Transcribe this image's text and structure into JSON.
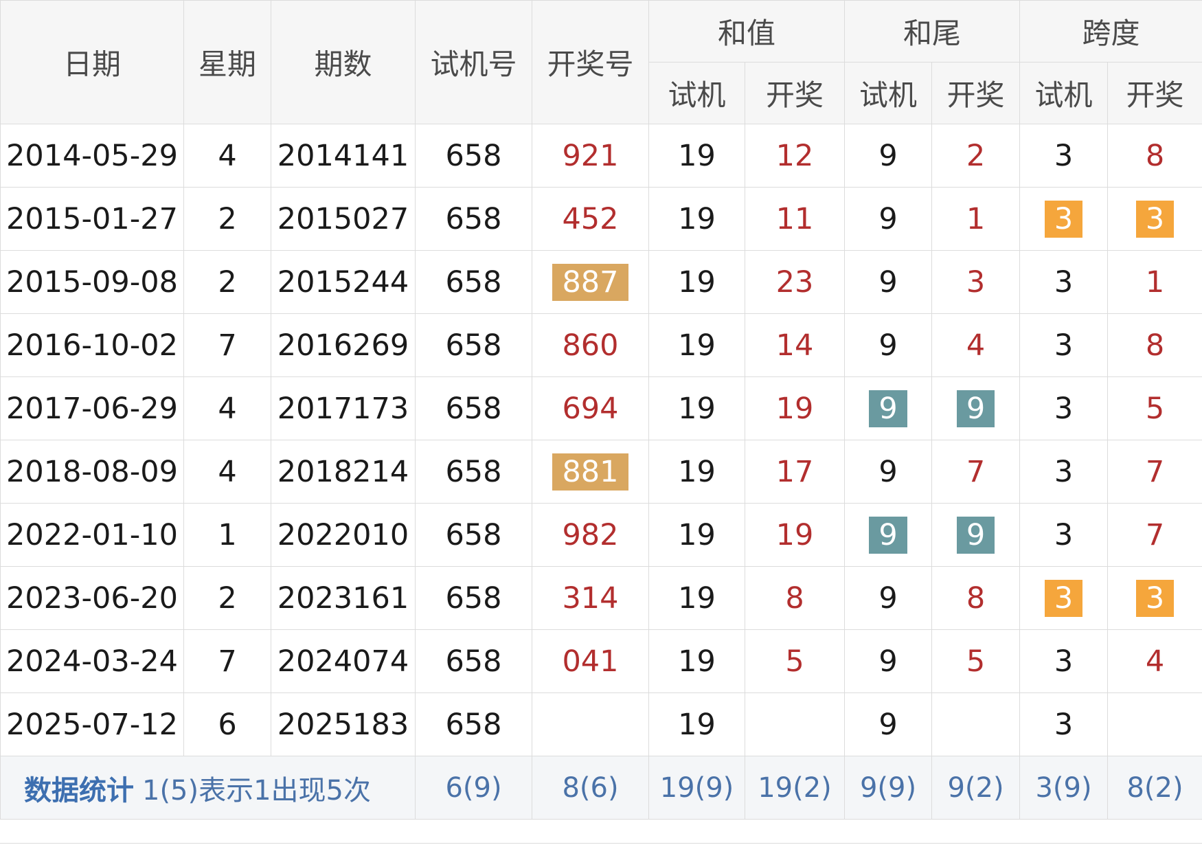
{
  "headers": {
    "date": "日期",
    "weekday": "星期",
    "period": "期数",
    "test_number": "试机号",
    "draw_number": "开奖号",
    "sum": "和值",
    "sum_tail": "和尾",
    "span": "跨度",
    "sub_test": "试机",
    "sub_draw": "开奖"
  },
  "rows": [
    {
      "date": "2014-05-29",
      "weekday": "4",
      "period": "2014141",
      "test": "658",
      "draw": "921",
      "sum_test": "19",
      "sum_draw": "12",
      "tail_test": "9",
      "tail_draw": "2",
      "span_test": "3",
      "span_draw": "8"
    },
    {
      "date": "2015-01-27",
      "weekday": "2",
      "period": "2015027",
      "test": "658",
      "draw": "452",
      "sum_test": "19",
      "sum_draw": "11",
      "tail_test": "9",
      "tail_draw": "1",
      "span_test": "3",
      "span_draw": "3"
    },
    {
      "date": "2015-09-08",
      "weekday": "2",
      "period": "2015244",
      "test": "658",
      "draw": "887",
      "sum_test": "19",
      "sum_draw": "23",
      "tail_test": "9",
      "tail_draw": "3",
      "span_test": "3",
      "span_draw": "1"
    },
    {
      "date": "2016-10-02",
      "weekday": "7",
      "period": "2016269",
      "test": "658",
      "draw": "860",
      "sum_test": "19",
      "sum_draw": "14",
      "tail_test": "9",
      "tail_draw": "4",
      "span_test": "3",
      "span_draw": "8"
    },
    {
      "date": "2017-06-29",
      "weekday": "4",
      "period": "2017173",
      "test": "658",
      "draw": "694",
      "sum_test": "19",
      "sum_draw": "19",
      "tail_test": "9",
      "tail_draw": "9",
      "span_test": "3",
      "span_draw": "5"
    },
    {
      "date": "2018-08-09",
      "weekday": "4",
      "period": "2018214",
      "test": "658",
      "draw": "881",
      "sum_test": "19",
      "sum_draw": "17",
      "tail_test": "9",
      "tail_draw": "7",
      "span_test": "3",
      "span_draw": "7"
    },
    {
      "date": "2022-01-10",
      "weekday": "1",
      "period": "2022010",
      "test": "658",
      "draw": "982",
      "sum_test": "19",
      "sum_draw": "19",
      "tail_test": "9",
      "tail_draw": "9",
      "span_test": "3",
      "span_draw": "7"
    },
    {
      "date": "2023-06-20",
      "weekday": "2",
      "period": "2023161",
      "test": "658",
      "draw": "314",
      "sum_test": "19",
      "sum_draw": "8",
      "tail_test": "9",
      "tail_draw": "8",
      "span_test": "3",
      "span_draw": "3"
    },
    {
      "date": "2024-03-24",
      "weekday": "7",
      "period": "2024074",
      "test": "658",
      "draw": "041",
      "sum_test": "19",
      "sum_draw": "5",
      "tail_test": "9",
      "tail_draw": "5",
      "span_test": "3",
      "span_draw": "4"
    },
    {
      "date": "2025-07-12",
      "weekday": "6",
      "period": "2025183",
      "test": "658",
      "draw": "",
      "sum_test": "19",
      "sum_draw": "",
      "tail_test": "9",
      "tail_draw": "",
      "span_test": "3",
      "span_draw": ""
    }
  ],
  "stats": {
    "title": "数据统计",
    "note": "1(5)表示1出现5次",
    "test": "6(9)",
    "draw": "8(6)",
    "sum_test": "19(9)",
    "sum_draw": "19(2)",
    "tail_test": "9(9)",
    "tail_draw": "9(2)",
    "span_test": "3(9)",
    "span_draw": "8(2)"
  },
  "colors": {
    "header_bg": "#f6f6f6",
    "draw_red": "#b22e2e",
    "highlight_gold": "#d9a760",
    "highlight_orange": "#f5a63c",
    "highlight_teal": "#6a9aa0",
    "stats_blue": "#4a72a8"
  }
}
